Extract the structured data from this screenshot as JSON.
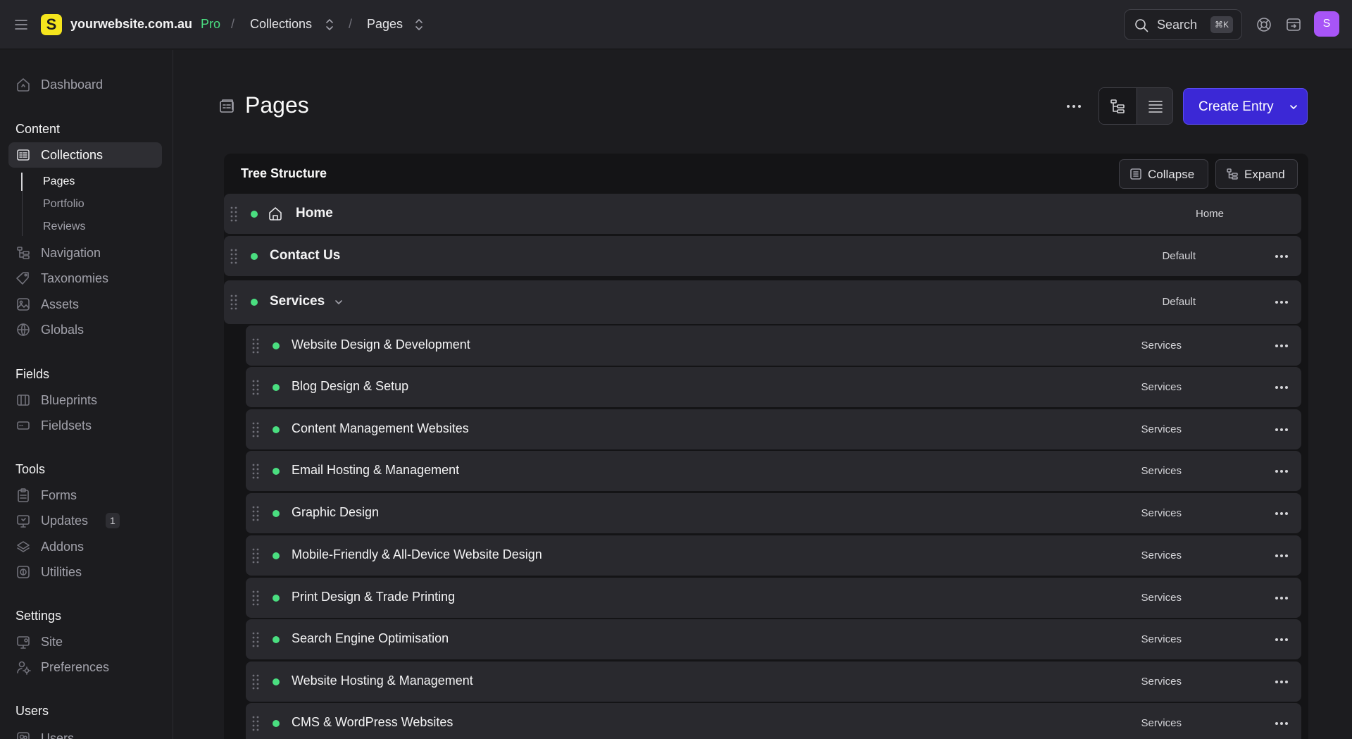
{
  "topbar": {
    "site_name": "yourwebsite.com.au",
    "logo_letter": "S",
    "edition": "Pro",
    "breadcrumbs": [
      "Collections",
      "Pages"
    ],
    "search_label": "Search",
    "search_shortcut": "⌘K",
    "avatar_initial": "S"
  },
  "sidebar": {
    "dashboard": "Dashboard",
    "content_heading": "Content",
    "collections": "Collections",
    "collection_children": [
      "Pages",
      "Portfolio",
      "Reviews"
    ],
    "navigation": "Navigation",
    "taxonomies": "Taxonomies",
    "assets": "Assets",
    "globals": "Globals",
    "fields_heading": "Fields",
    "blueprints": "Blueprints",
    "fieldsets": "Fieldsets",
    "tools_heading": "Tools",
    "forms": "Forms",
    "updates": "Updates",
    "updates_count": "1",
    "addons": "Addons",
    "utilities": "Utilities",
    "settings_heading": "Settings",
    "site": "Site",
    "preferences": "Preferences",
    "users_heading": "Users",
    "users": "Users"
  },
  "main": {
    "title": "Pages",
    "create_label": "Create Entry",
    "tree_title": "Tree Structure",
    "collapse_label": "Collapse",
    "expand_label": "Expand",
    "status_color": "#4ade80",
    "accent_color": "#3b28d6",
    "rows": [
      {
        "title": "Home",
        "blueprint": "Home"
      },
      {
        "title": "Contact Us",
        "blueprint": "Default"
      },
      {
        "title": "Services",
        "blueprint": "Default"
      },
      {
        "title": "Website Design & Development",
        "blueprint": "Services"
      },
      {
        "title": "Blog Design & Setup",
        "blueprint": "Services"
      },
      {
        "title": "Content Management Websites",
        "blueprint": "Services"
      },
      {
        "title": "Email Hosting & Management",
        "blueprint": "Services"
      },
      {
        "title": "Graphic Design",
        "blueprint": "Services"
      },
      {
        "title": "Mobile-Friendly & All-Device Website Design",
        "blueprint": "Services"
      },
      {
        "title": "Print Design & Trade Printing",
        "blueprint": "Services"
      },
      {
        "title": "Search Engine Optimisation",
        "blueprint": "Services"
      },
      {
        "title": "Website Hosting & Management",
        "blueprint": "Services"
      },
      {
        "title": "CMS & WordPress Websites",
        "blueprint": "Services"
      }
    ]
  }
}
